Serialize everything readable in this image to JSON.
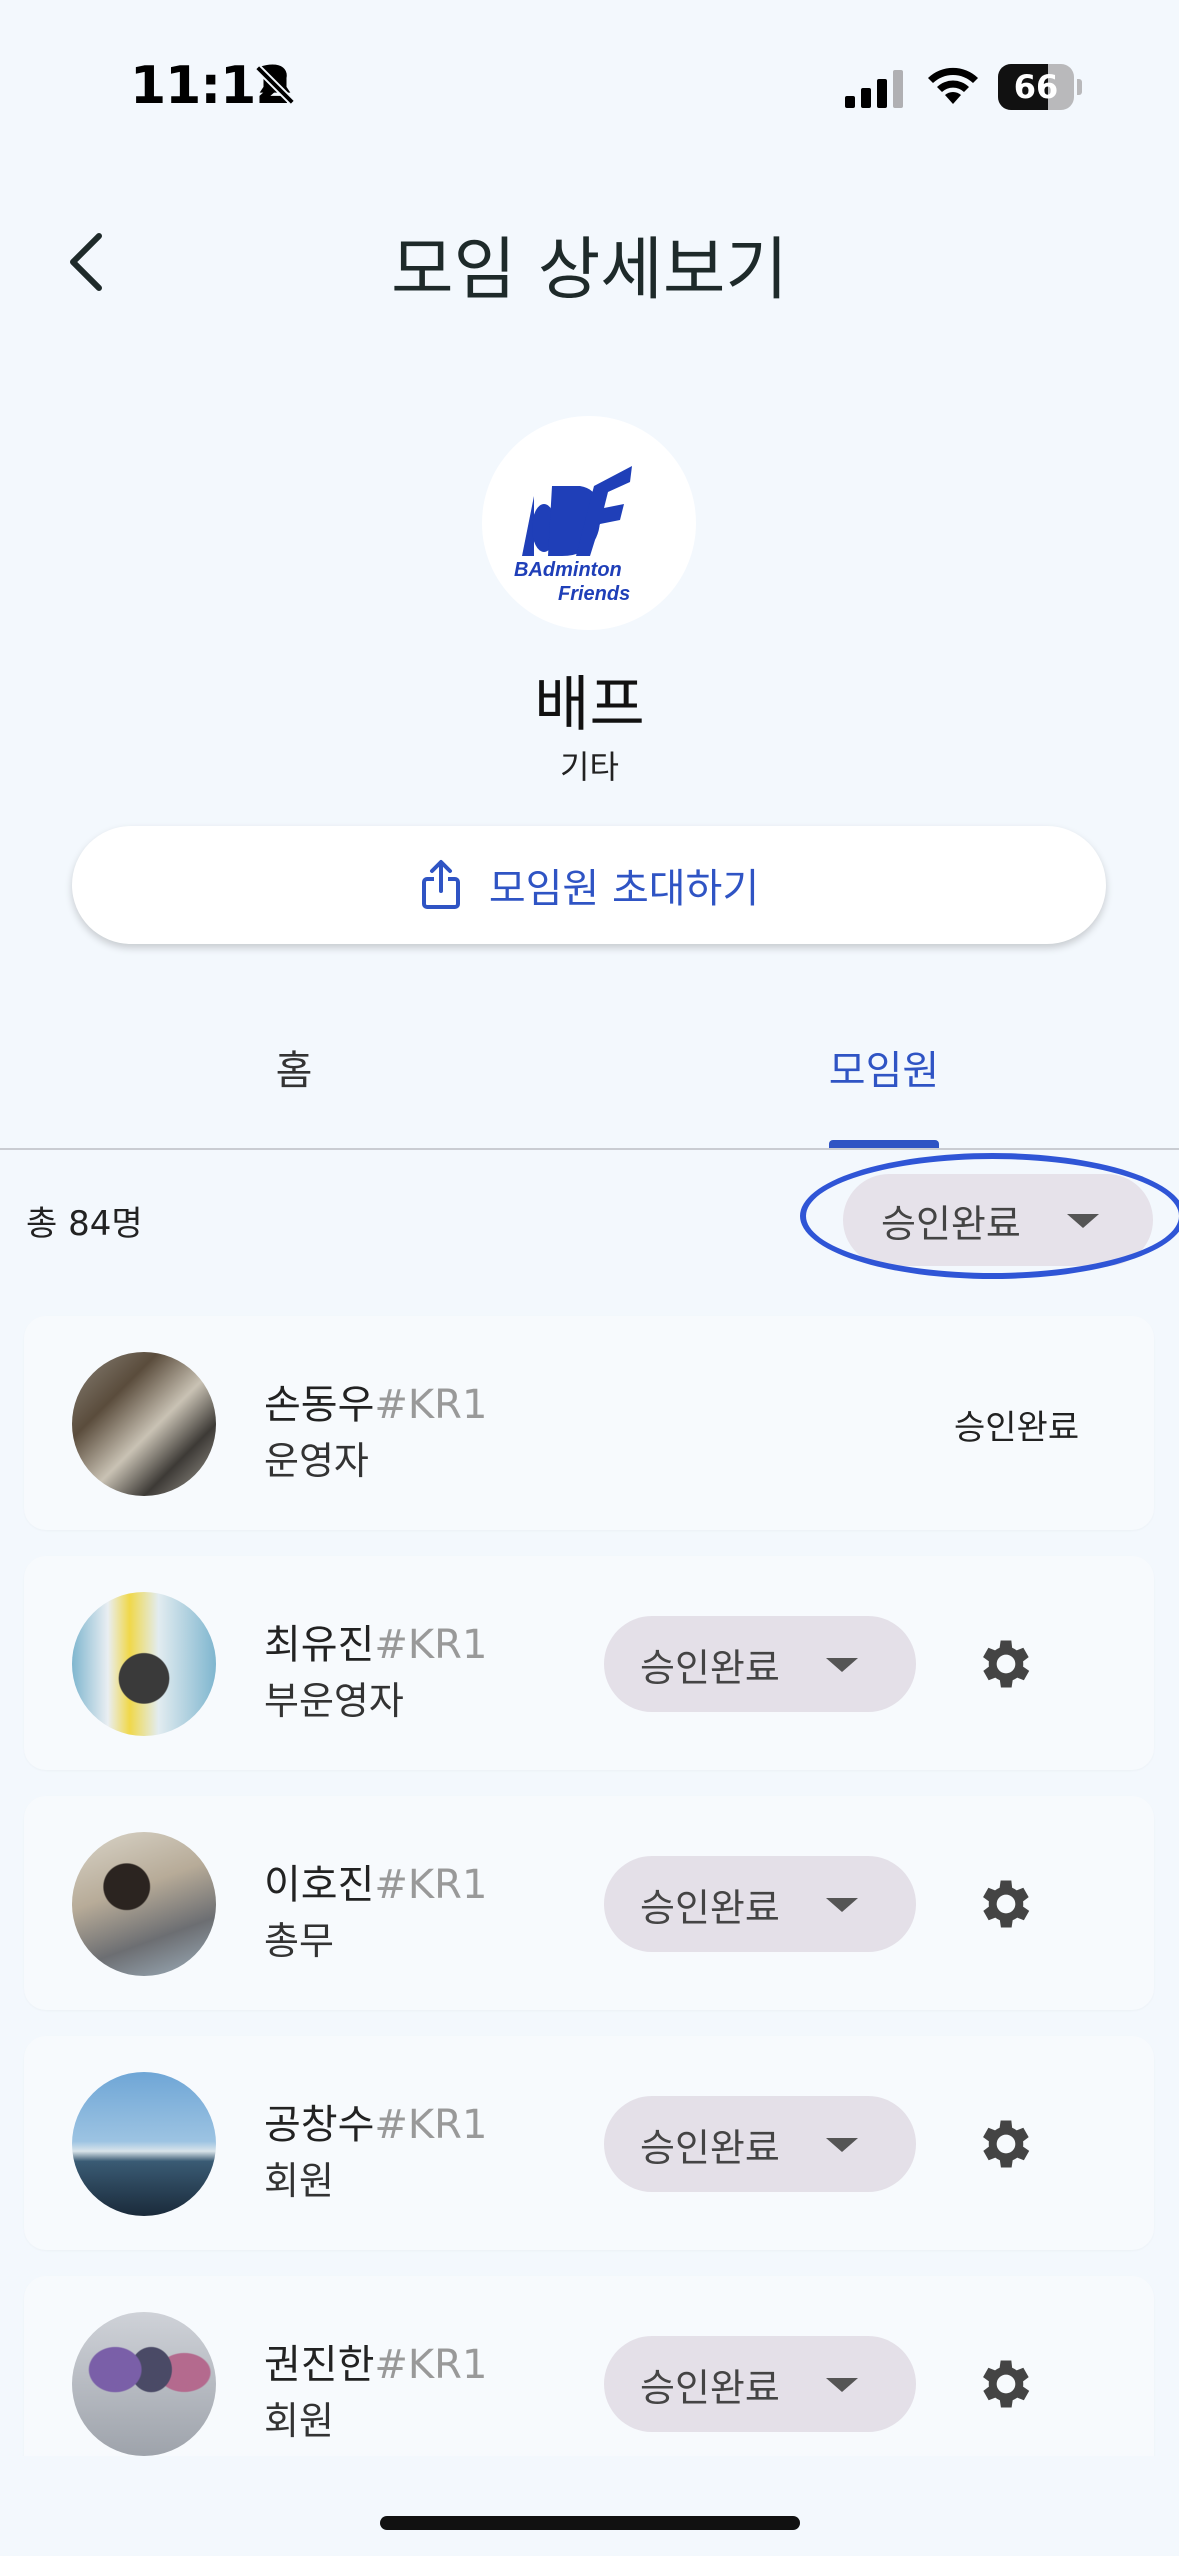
{
  "status_bar": {
    "time": "11:12",
    "battery_text": "66",
    "battery_level_percent": 66
  },
  "header": {
    "title": "모임 상세보기",
    "back_icon": "chevron-left-icon"
  },
  "group": {
    "name": "배프",
    "category": "기타",
    "logo_text": "BAdminton Friends",
    "logo_color": "#1f3fb8"
  },
  "invite_button": {
    "label": "모임원 초대하기",
    "icon": "share-icon"
  },
  "tabs": [
    {
      "label": "홈",
      "active": false
    },
    {
      "label": "모임원",
      "active": true
    }
  ],
  "members_summary": {
    "total": "총 84명",
    "filter_value": "승인완료"
  },
  "members": [
    {
      "name": "손동우",
      "tag": "#KR1",
      "role": "운영자",
      "status": "승인완료",
      "editable": false
    },
    {
      "name": "최유진",
      "tag": "#KR1",
      "role": "부운영자",
      "status": "승인완료",
      "editable": true
    },
    {
      "name": "이호진",
      "tag": "#KR1",
      "role": "총무",
      "status": "승인완료",
      "editable": true
    },
    {
      "name": "공창수",
      "tag": "#KR1",
      "role": "회원",
      "status": "승인완료",
      "editable": true
    },
    {
      "name": "권진한",
      "tag": "#KR1",
      "role": "회원",
      "status": "승인완료",
      "editable": true
    }
  ],
  "colors": {
    "accent": "#2f54c4",
    "background": "#f3f8fd",
    "dropdown_bg": "#e4e0e8",
    "annotation": "#2f55d6"
  }
}
